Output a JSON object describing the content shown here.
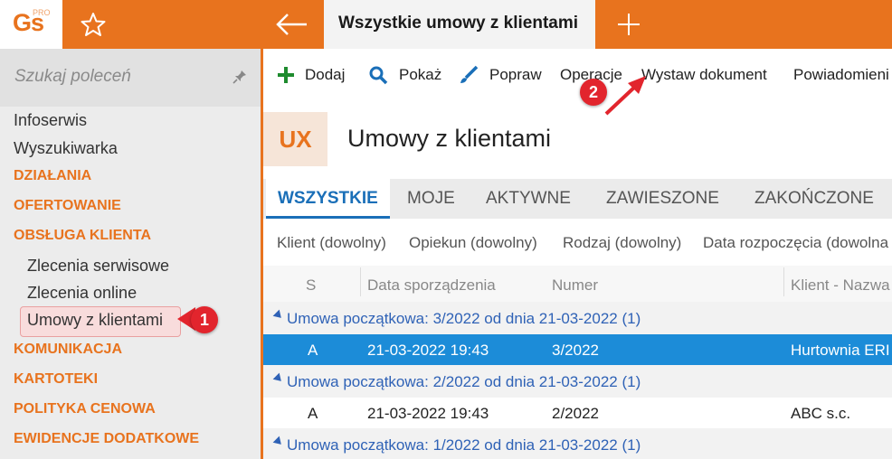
{
  "app": {
    "logo_text": "Gs",
    "logo_badge": "PRO",
    "active_tab": "Wszystkie umowy z klientami"
  },
  "sidebar": {
    "search_placeholder": "Szukaj poleceń",
    "items": [
      {
        "label": "Infoserwis",
        "kind": "plain"
      },
      {
        "label": "Wyszukiwarka",
        "kind": "plain"
      },
      {
        "label": "DZIAŁANIA",
        "kind": "section"
      },
      {
        "label": "OFERTOWANIE",
        "kind": "section"
      },
      {
        "label": "OBSŁUGA KLIENTA",
        "kind": "section"
      },
      {
        "label": "Zlecenia serwisowe",
        "kind": "sub"
      },
      {
        "label": "Zlecenia online",
        "kind": "sub"
      },
      {
        "label": "Umowy z klientami",
        "kind": "sub",
        "selected": true
      },
      {
        "label": "KOMUNIKACJA",
        "kind": "section"
      },
      {
        "label": "KARTOTEKI",
        "kind": "section"
      },
      {
        "label": "POLITYKA CENOWA",
        "kind": "section"
      },
      {
        "label": "EWIDENCJE DODATKOWE",
        "kind": "section"
      }
    ]
  },
  "callouts": {
    "one": "1",
    "two": "2"
  },
  "toolbar": {
    "add": "Dodaj",
    "show": "Pokaż",
    "edit": "Popraw",
    "operations": "Operacje",
    "issue_document": "Wystaw dokument",
    "notifications": "Powiadomieni"
  },
  "page": {
    "badge": "UX",
    "title": "Umowy z klientami"
  },
  "tabs": [
    "WSZYSTKIE",
    "MOJE",
    "AKTYWNE",
    "ZAWIESZONE",
    "ZAKOŃCZONE"
  ],
  "filters": [
    "Klient (dowolny)",
    "Opiekun (dowolny)",
    "Rodzaj (dowolny)",
    "Data rozpoczęcia (dowolna"
  ],
  "table": {
    "columns": [
      "S",
      "Data sporządzenia",
      "Numer",
      "Klient - Nazwa"
    ],
    "groups": [
      {
        "label": "Umowa początkowa: 3/2022 od dnia 21-03-2022",
        "count": "(1)",
        "row": {
          "s": "A",
          "date": "21-03-2022 19:43",
          "number": "3/2022",
          "client": "Hurtownia ERI"
        }
      },
      {
        "label": "Umowa początkowa: 2/2022 od dnia 21-03-2022",
        "count": "(1)",
        "row": {
          "s": "A",
          "date": "21-03-2022 19:43",
          "number": "2/2022",
          "client": "ABC s.c."
        }
      },
      {
        "label": "Umowa początkowa: 1/2022 od dnia 21-03-2022",
        "count": "(1)"
      }
    ]
  },
  "colors": {
    "brand_orange": "#E8731E",
    "selection_blue": "#1C8CD8",
    "link_blue": "#2f62b6",
    "callout_red": "#E2252D"
  }
}
